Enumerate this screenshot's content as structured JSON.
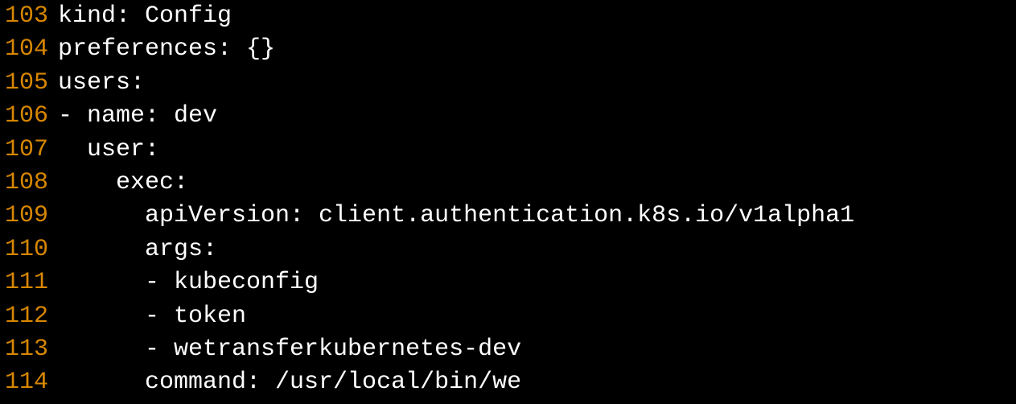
{
  "lines": [
    {
      "number": "103",
      "code": "kind: Config"
    },
    {
      "number": "104",
      "code": "preferences: {}"
    },
    {
      "number": "105",
      "code": "users:"
    },
    {
      "number": "106",
      "code": "- name: dev"
    },
    {
      "number": "107",
      "code": "  user:"
    },
    {
      "number": "108",
      "code": "    exec:"
    },
    {
      "number": "109",
      "code": "      apiVersion: client.authentication.k8s.io/v1alpha1"
    },
    {
      "number": "110",
      "code": "      args:"
    },
    {
      "number": "111",
      "code": "      - kubeconfig"
    },
    {
      "number": "112",
      "code": "      - token"
    },
    {
      "number": "113",
      "code": "      - wetransferkubernetes-dev"
    },
    {
      "number": "114",
      "code": "      command: /usr/local/bin/we"
    }
  ]
}
